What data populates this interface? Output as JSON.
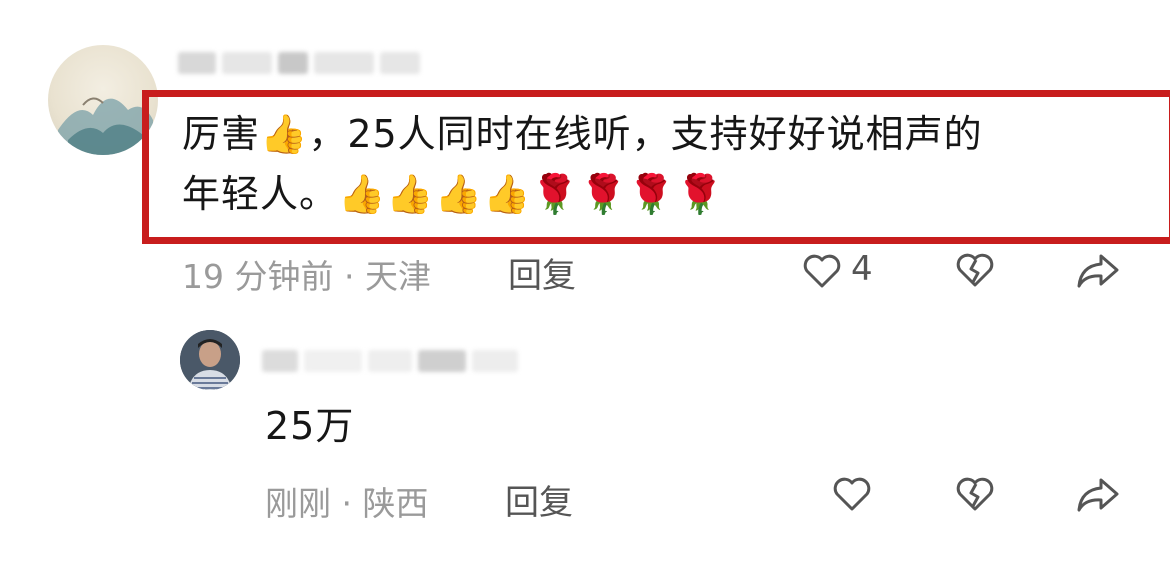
{
  "comments": [
    {
      "text_line1": "厉害👍，25人同时在线听，支持好好说相声的",
      "text_line2": "年轻人。👍👍👍👍🌹🌹🌹🌹",
      "time_location": "19 分钟前 · 天津",
      "reply_label": "回复",
      "like_count": "4"
    },
    {
      "text": "25万",
      "time_location": "刚刚 · 陕西",
      "reply_label": "回复"
    }
  ],
  "colors": {
    "highlight": "#c81d1d",
    "meta": "#9a9a9a"
  },
  "icons": [
    "heart-icon",
    "dislike-heart-icon",
    "share-icon"
  ]
}
